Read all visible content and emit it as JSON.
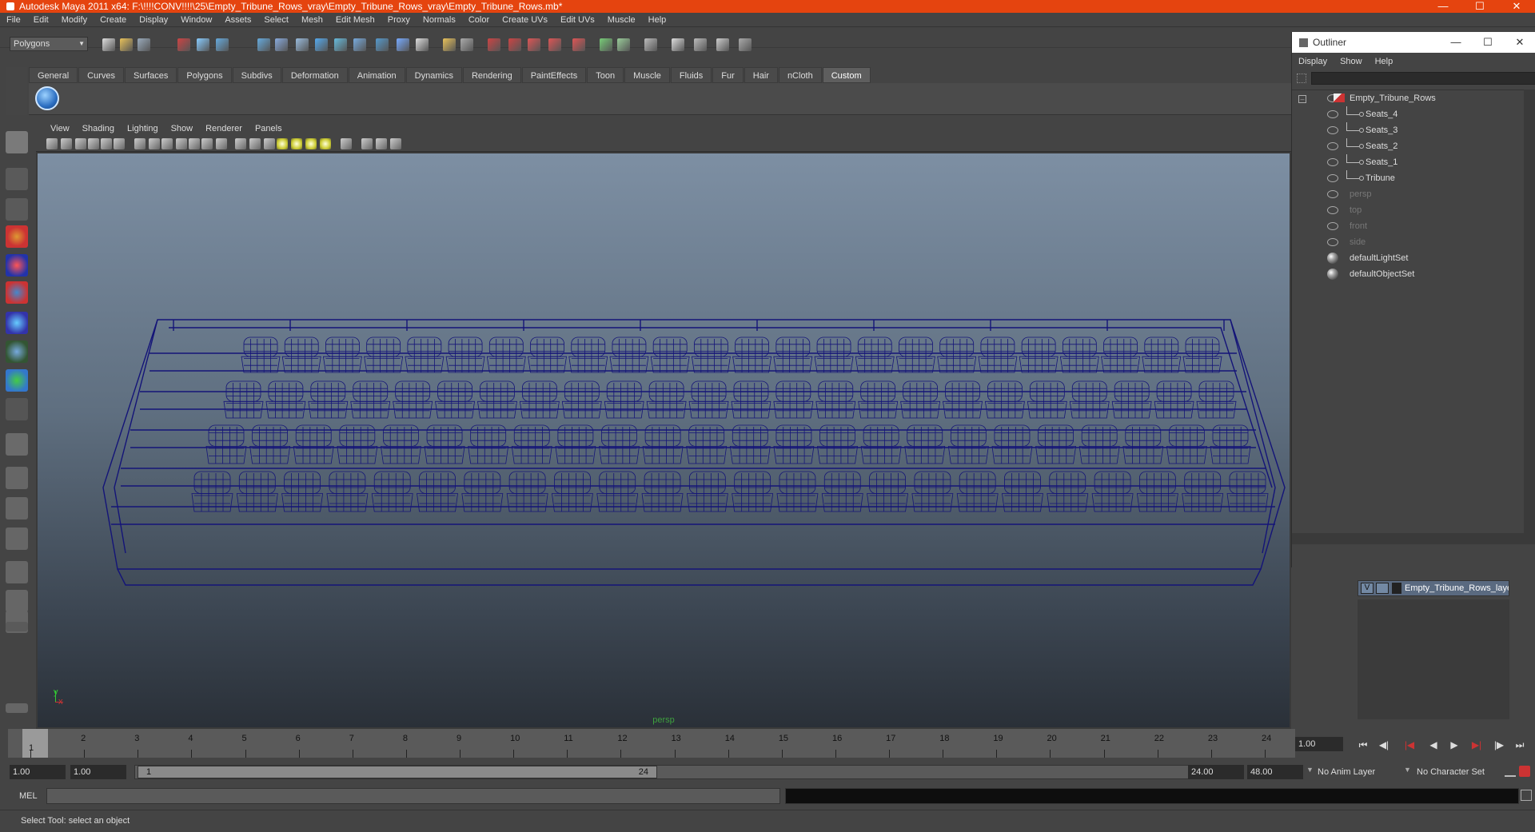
{
  "window": {
    "title": "Autodesk Maya 2011 x64: F:\\!!!!CONV!!!!\\25\\Empty_Tribune_Rows_vray\\Empty_Tribune_Rows_vray\\Empty_Tribune_Rows.mb*",
    "accent_color": "#e5440f"
  },
  "menubar": [
    "File",
    "Edit",
    "Modify",
    "Create",
    "Display",
    "Window",
    "Assets",
    "Select",
    "Mesh",
    "Edit Mesh",
    "Proxy",
    "Normals",
    "Color",
    "Create UVs",
    "Edit UVs",
    "Muscle",
    "Help"
  ],
  "statusline": {
    "mode": "Polygons"
  },
  "shelf": {
    "tabs": [
      "General",
      "Curves",
      "Surfaces",
      "Polygons",
      "Subdivs",
      "Deformation",
      "Animation",
      "Dynamics",
      "Rendering",
      "PaintEffects",
      "Toon",
      "Muscle",
      "Fluids",
      "Fur",
      "Hair",
      "nCloth",
      "Custom"
    ],
    "active_tab": "Custom"
  },
  "panel": {
    "menus": [
      "View",
      "Shading",
      "Lighting",
      "Show",
      "Renderer",
      "Panels"
    ],
    "camera": "persp",
    "axis_x": "x",
    "axis_y": "y",
    "wire_color": "#141478"
  },
  "outliner": {
    "title": "Outliner",
    "menus": [
      "Display",
      "Show",
      "Help"
    ],
    "items": [
      {
        "label": "Empty_Tribune_Rows",
        "dim": false,
        "kind": "group"
      },
      {
        "label": "Seats_4",
        "dim": false,
        "kind": "child"
      },
      {
        "label": "Seats_3",
        "dim": false,
        "kind": "child"
      },
      {
        "label": "Seats_2",
        "dim": false,
        "kind": "child"
      },
      {
        "label": "Seats_1",
        "dim": false,
        "kind": "child"
      },
      {
        "label": "Tribune",
        "dim": false,
        "kind": "child"
      },
      {
        "label": "persp",
        "dim": true,
        "kind": "camera"
      },
      {
        "label": "top",
        "dim": true,
        "kind": "camera"
      },
      {
        "label": "front",
        "dim": true,
        "kind": "camera"
      },
      {
        "label": "side",
        "dim": true,
        "kind": "camera"
      },
      {
        "label": "defaultLightSet",
        "dim": false,
        "kind": "set"
      },
      {
        "label": "defaultObjectSet",
        "dim": false,
        "kind": "set"
      }
    ]
  },
  "layers": {
    "visible_flag": "V",
    "name": "Empty_Tribune_Rows_layer"
  },
  "time": {
    "ticks": [
      "1",
      "2",
      "3",
      "4",
      "5",
      "6",
      "7",
      "8",
      "9",
      "10",
      "11",
      "12",
      "13",
      "14",
      "15",
      "16",
      "17",
      "18",
      "19",
      "20",
      "21",
      "22",
      "23",
      "24"
    ],
    "current_frame": "1.00",
    "current_marker": "1",
    "range_start": "1.00",
    "playback_start": "1.00",
    "range_handle_start": "1",
    "range_handle_end": "24",
    "playback_end": "24.00",
    "range_end": "48.00",
    "anim_layer": "No Anim Layer",
    "character_set": "No Character Set"
  },
  "command": {
    "label": "MEL"
  },
  "help": {
    "text": "Select Tool: select an object"
  }
}
